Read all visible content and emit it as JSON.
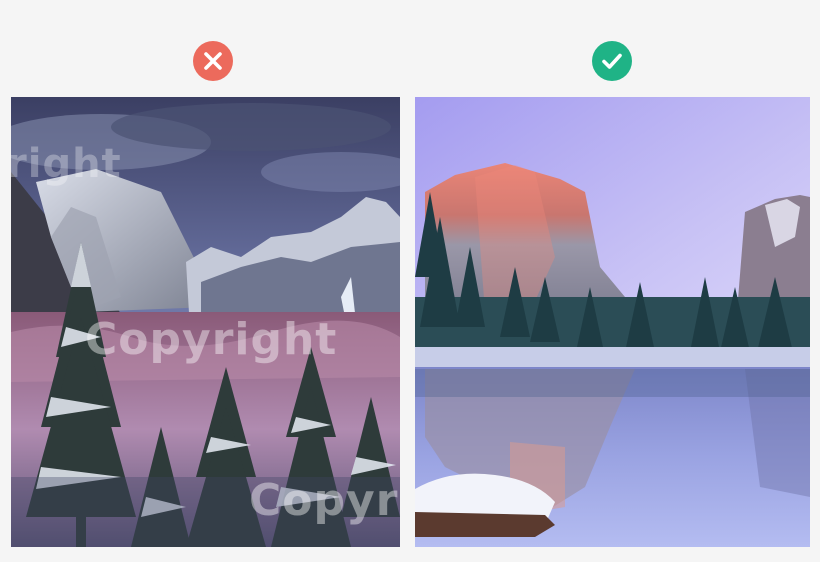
{
  "comparison": {
    "bad": {
      "status_icon": "cross-icon",
      "status_color": "#ec6a5c",
      "image_subject": "snowy-valley-with-watermark",
      "watermarks": [
        "right",
        "Copyright",
        "Copyr"
      ]
    },
    "good": {
      "status_icon": "check-icon",
      "status_color": "#1fb386",
      "image_subject": "mountain-lake-reflection-clean"
    }
  }
}
